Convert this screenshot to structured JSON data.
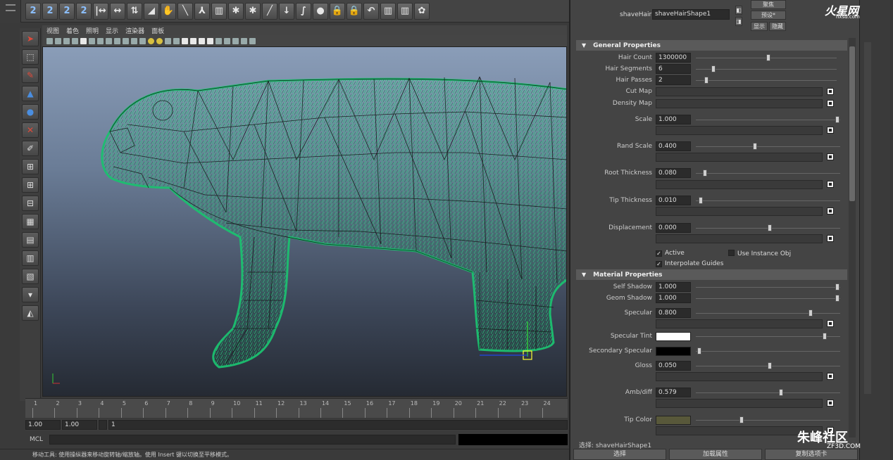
{
  "shelf": {
    "icons": [
      "2",
      "2",
      "2",
      "2",
      "|↔",
      "↔",
      "⇅",
      "◢",
      "✋",
      "╲",
      "⅄",
      "▥",
      "✱",
      "✱",
      "╱",
      "↓",
      "∫",
      "●",
      "🔒",
      "🔒",
      "↶",
      "▥",
      "▥",
      "✿"
    ]
  },
  "toolbox": {
    "icons": [
      "select-arrow-icon",
      "lasso-icon",
      "paint-icon",
      "move-icon",
      "rotate-icon",
      "scale-icon",
      "brush-icon",
      "layout-single-icon",
      "layout-four-icon",
      "layout-split-icon",
      "layout-graph-icon",
      "layout-outliner-icon",
      "layout-hypershade-icon",
      "layout-custom-icon",
      "collapse-icon",
      "render-icon"
    ]
  },
  "viewport_menu": [
    "视图",
    "着色",
    "照明",
    "显示",
    "渲染器",
    "面板"
  ],
  "timeline": {
    "ticks": [
      "1",
      "2",
      "3",
      "4",
      "5",
      "6",
      "7",
      "8",
      "9",
      "10",
      "11",
      "12",
      "13",
      "14",
      "15",
      "16",
      "17",
      "18",
      "19",
      "20",
      "21",
      "22",
      "23",
      "24"
    ]
  },
  "range": {
    "start": "1.00",
    "current": "1.00",
    "frame": "1"
  },
  "cmdline": {
    "label": "MCL"
  },
  "helpline": {
    "text": "移动工具: 使用操纵器来移动旋转轴/缩放轴。使用 Insert 键以切换至平移模式。"
  },
  "ae": {
    "node_label": "shaveHair:",
    "node_name": "shaveHairShape1",
    "buttons": {
      "focus": "聚焦",
      "presets": "预设*",
      "show": "显示",
      "hide": "隐藏"
    },
    "general": {
      "title": "General Properties",
      "hair_count": {
        "label": "Hair Count",
        "value": "1300000"
      },
      "hair_segments": {
        "label": "Hair Segments",
        "value": "6"
      },
      "hair_passes": {
        "label": "Hair Passes",
        "value": "2"
      },
      "cut_map": {
        "label": "Cut Map"
      },
      "density_map": {
        "label": "Density Map"
      },
      "scale": {
        "label": "Scale",
        "value": "1.000"
      },
      "rand_scale": {
        "label": "Rand Scale",
        "value": "0.400"
      },
      "root_thickness": {
        "label": "Root Thickness",
        "value": "0.080"
      },
      "tip_thickness": {
        "label": "Tip Thickness",
        "value": "0.010"
      },
      "displacement": {
        "label": "Displacement",
        "value": "0.000"
      },
      "active": "Active",
      "use_instance": "Use Instance Obj",
      "interpolate": "Interpolate Guides"
    },
    "material": {
      "title": "Material Properties",
      "self_shadow": {
        "label": "Self Shadow",
        "value": "1.000"
      },
      "geom_shadow": {
        "label": "Geom Shadow",
        "value": "1.000"
      },
      "specular": {
        "label": "Specular",
        "value": "0.800"
      },
      "specular_tint": {
        "label": "Specular Tint",
        "color": "#ffffff"
      },
      "secondary_specular": {
        "label": "Secondary Specular",
        "color": "#000000"
      },
      "gloss": {
        "label": "Gloss",
        "value": "0.050"
      },
      "amb_diff": {
        "label": "Amb/diff",
        "value": "0.579"
      },
      "tip_color": {
        "label": "Tip Color",
        "color": "#58583a"
      }
    },
    "footer_name": "选择: shaveHairShape1",
    "footer_buttons": [
      "选择",
      "加载属性",
      "复制选项卡"
    ]
  },
  "branding": {
    "logo": "火星网",
    "logo_sub": "hxsd.com",
    "watermark": "朱峰社区",
    "watermark_sub": "ZF3D.COM"
  }
}
